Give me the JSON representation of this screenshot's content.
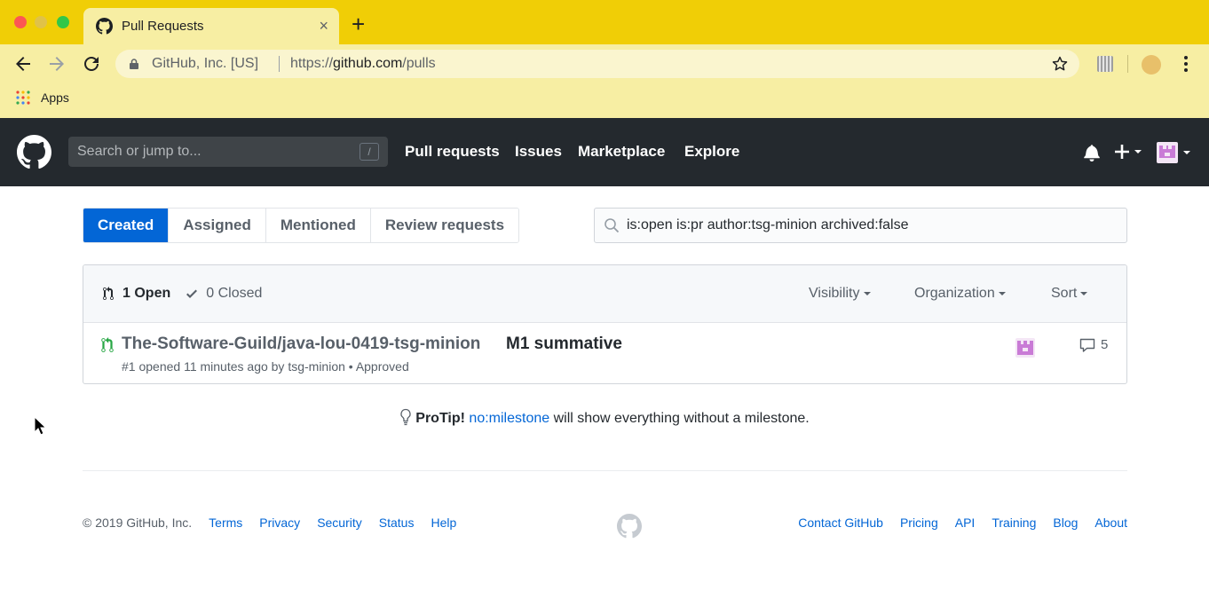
{
  "browser": {
    "tab_title": "Pull Requests",
    "tab_close": "×",
    "new_tab": "+",
    "site_identity": "GitHub, Inc. [US]",
    "url_scheme": "https://",
    "url_host": "github.com",
    "url_path": "/pulls",
    "bookmark_apps": "Apps"
  },
  "header": {
    "search_placeholder": "Search or jump to...",
    "search_key": "/",
    "nav": [
      "Pull requests",
      "Issues",
      "Marketplace",
      "Explore"
    ]
  },
  "subnav": {
    "tabs": [
      "Created",
      "Assigned",
      "Mentioned",
      "Review requests"
    ],
    "selected": "Created",
    "query": "is:open is:pr author:tsg-minion archived:false"
  },
  "list": {
    "open_label": "1 Open",
    "closed_label": "0 Closed",
    "filters": [
      "Visibility",
      "Organization",
      "Sort"
    ],
    "items": [
      {
        "repo": "The-Software-Guild/java-lou-0419-tsg-minion",
        "title": "M1 summative",
        "meta": "#1 opened 11 minutes ago by tsg-minion • Approved",
        "comments": "5"
      }
    ]
  },
  "protip": {
    "label": "ProTip!",
    "link": "no:milestone",
    "text": " will show everything without a milestone."
  },
  "footer": {
    "copyright": "© 2019 GitHub, Inc.",
    "left_links": [
      "Terms",
      "Privacy",
      "Security",
      "Status",
      "Help"
    ],
    "right_links": [
      "Contact GitHub",
      "Pricing",
      "API",
      "Training",
      "Blog",
      "About"
    ]
  },
  "colors": {
    "tab_strip": "#f0ce06",
    "toolbar": "#f7eea3",
    "header_bg": "#24292e",
    "accent": "#0366d6",
    "pr_open": "#28a745"
  },
  "icons": [
    "github-mark-icon",
    "back-arrow-icon",
    "forward-arrow-icon",
    "reload-icon",
    "lock-icon",
    "star-icon",
    "bell-icon",
    "plus-icon",
    "search-icon",
    "pull-request-icon",
    "check-icon",
    "comment-icon",
    "lightbulb-icon"
  ]
}
